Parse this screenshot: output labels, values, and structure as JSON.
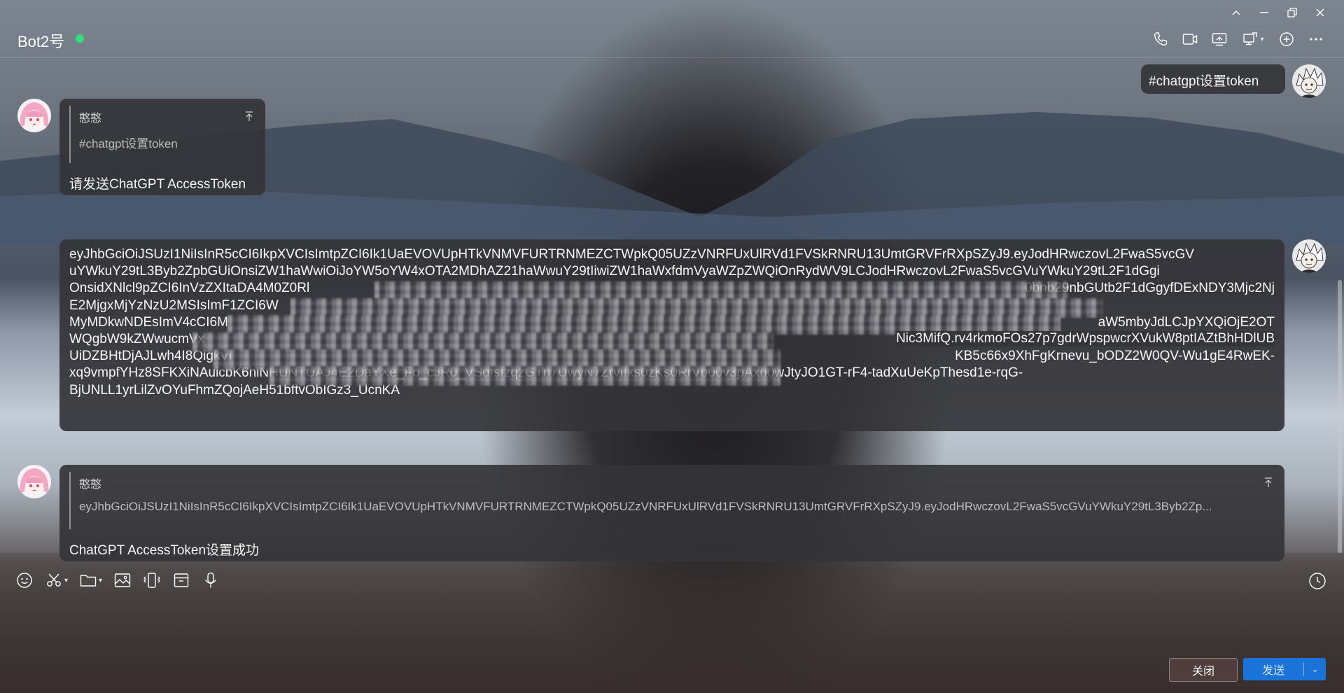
{
  "window_controls": [
    "collapse-icon",
    "minimize-icon",
    "restore-icon",
    "close-icon"
  ],
  "header": {
    "chat_name": "Bot2号",
    "status_color": "#2ee07a",
    "actions": [
      "phone-icon",
      "video-icon",
      "screen-share-icon",
      "remote-control-icon",
      "add-member-icon",
      "more-icon"
    ]
  },
  "messages": [
    {
      "side": "right",
      "text": "#chatgpt设置token"
    },
    {
      "side": "left",
      "quote": {
        "name": "憨憨",
        "text": "#chatgpt设置token"
      },
      "text": "请发送ChatGPT AccessToken"
    },
    {
      "side": "right",
      "token_lines": [
        "eyJhbGciOiJSUzI1NiIsInR5cCI6IkpXVCIsImtpZCI6Ik1UaEVOVUpHTkVNMVFURTRNMEZCTWpkQ05UZzVNRFUxUlRVd1FVSkRNRU13UmtGRVFrRXpSZyJ9.eyJodHRwczovL2FwaS5vcGV",
        "uYWkuY29tL3Byb2ZpbGUiOnsiZW1haWwiOiJoYW5oYW4xOTA2MDhAZ21haWwuY29tIiwiZW1haWxfdmVyaWZpZWQiOnRydWV9LCJodHRwczovL2FwaS5vcGVuYWkuY29tL2F1dGgi",
        "OnsidXNlcl9pZCI6InVzZXItaDA4M0Z0Rl",
        "E2MjgxMjYzNzU2MSIsImF1ZCI6W",
        "MyMDkwNDEsImV4cCI6M",
        "WQgbW9kZWwucmVx",
        "UiDZBHtDjAJLwh4I8QigkVl",
        "xq9vmpfYHz8SFKXiNAuicbK6hlNHUNTUAJ4E2DaYXe_Fb_cJR0_VSdfsfzqzGTn7UwyN7ZrvIfks0zKs0RrVb00v3pAxh0wJtyJO1GT-rF4-tadXuUeKpThesd1e-rqG-",
        "BjUNLL1yrLilZvOYuFhmZQojAeH51bftvObIGz3_UcnKA"
      ],
      "token_tail_fragments": [
        "0bnb29nbGUtb2F1dGgyfDExNDY3Mjc2Nj",
        "aW5mbyJdLCJpYXQiOjE2OT",
        "Nic3MifQ.rv4rkmoFOs27p7gdrWpspwcrXVukW8ptIAZtBhHDlUB",
        "KB5c66x9XhFgKrnevu_bODZ2W0QV-Wu1gE4RwEK-"
      ]
    },
    {
      "side": "left",
      "quote": {
        "name": "憨憨",
        "text": "eyJhbGciOiJSUzI1NiIsInR5cCI6IkpXVCIsImtpZCI6Ik1UaEVOVUpHTkVNMVFURTRNMEZCTWpkQ05UZzVNRFUxUlRVd1FVSkRNRU13UmtGRVFrRXpSZyJ9.eyJodHRwczovL2FwaS5vcGVuYWkuY29tL3Byb2Zp..."
      },
      "text": "ChatGPT AccessToken设置成功"
    }
  ],
  "toolbar": [
    "emoji-icon",
    "scissors-icon",
    "folder-icon",
    "image-icon",
    "vibrate-icon",
    "box-icon",
    "microphone-icon"
  ],
  "footer": {
    "close_label": "关闭",
    "send_label": "发送",
    "send_color": "#1a73d9"
  }
}
